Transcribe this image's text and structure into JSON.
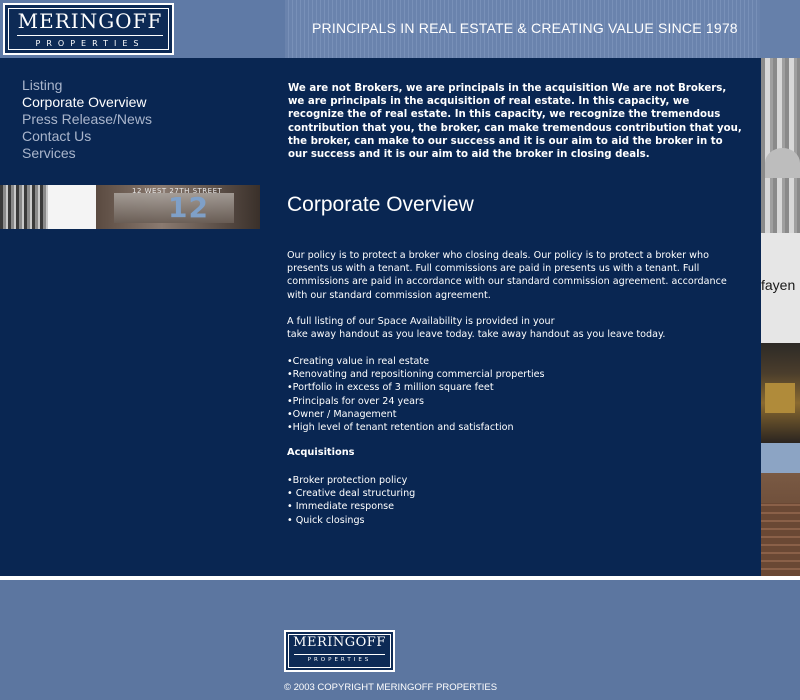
{
  "brand": {
    "name": "MERINGOFF",
    "subtitle": "PROPERTIES"
  },
  "header": {
    "tagline": "PRINCIPALS IN REAL ESTATE  &  CREATING VALUE SINCE 1978"
  },
  "nav": {
    "items": [
      {
        "label": "Listing",
        "active": false
      },
      {
        "label": "Corporate Overview",
        "active": true
      },
      {
        "label": "Press Release/News",
        "active": false
      },
      {
        "label": "Contact Us",
        "active": false
      },
      {
        "label": "Services",
        "active": false
      }
    ]
  },
  "photo": {
    "address": "12 WEST 27TH STREET",
    "number": "12",
    "storefront_text": "fayen"
  },
  "main": {
    "intro": "We are not Brokers, we are principals in the acquisition We are not Brokers, we are principals in the acquisition of real estate. In this capacity, we recognize the of real estate. In this capacity, we recognize the tremendous contribution that you, the broker, can make tremendous contribution that you, the broker, can make to our success and it is our aim to aid the broker in to our success and it is our aim to aid the broker in closing deals.",
    "title": "Corporate Overview",
    "policy": "Our policy is to protect a broker who closing deals. Our policy is to protect a broker who presents us with a tenant. Full commissions are paid in presents us with a tenant. Full commissions are paid in accordance with our standard commission agreement. accordance with our standard commission agreement.",
    "availability_line1": "A full listing of our Space Availability is provided in your",
    "availability_line2": "take away handout as you leave today. take away handout as you leave today.",
    "highlights": [
      "Creating value in real estate",
      "Renovating and repositioning commercial properties",
      "Portfolio in excess of 3 million square feet",
      "Principals for over 24 years",
      "Owner / Management",
      "High level of tenant retention and satisfaction"
    ],
    "acquisitions_title": "Acquisitions",
    "acquisitions": [
      "Broker protection policy",
      " Creative deal structuring",
      " Immediate response",
      " Quick closings"
    ]
  },
  "footer": {
    "copyright": "© 2003 COPYRIGHT MERINGOFF PROPERTIES"
  }
}
